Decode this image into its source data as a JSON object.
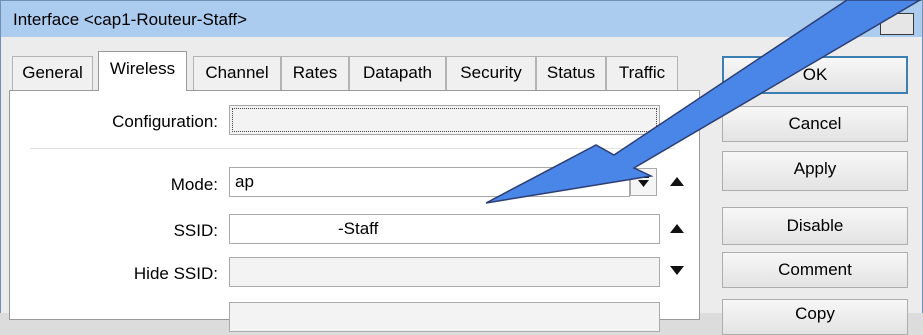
{
  "window": {
    "title": "Interface <cap1-Routeur-Staff>"
  },
  "tabs": [
    {
      "label": "General"
    },
    {
      "label": "Wireless"
    },
    {
      "label": "Channel"
    },
    {
      "label": "Rates"
    },
    {
      "label": "Datapath"
    },
    {
      "label": "Security"
    },
    {
      "label": "Status"
    },
    {
      "label": "Traffic"
    }
  ],
  "form": {
    "configuration_label": "Configuration:",
    "configuration_value": "",
    "mode_label": "Mode:",
    "mode_value": "ap",
    "ssid_label": "SSID:",
    "ssid_value": "-Staff",
    "hide_ssid_label": "Hide SSID:",
    "hide_ssid_value": ""
  },
  "buttons": {
    "ok": "OK",
    "cancel": "Cancel",
    "apply": "Apply",
    "disable": "Disable",
    "comment": "Comment",
    "copy": "Copy"
  },
  "colors": {
    "titlebar": "#abcbef",
    "callout_fill": "#4a86e8",
    "callout_stroke": "#2c3e72"
  },
  "icons": {
    "dropdown": "dropdown-arrow-icon",
    "collapse": "up-triangle-icon",
    "expand": "down-triangle-icon"
  }
}
